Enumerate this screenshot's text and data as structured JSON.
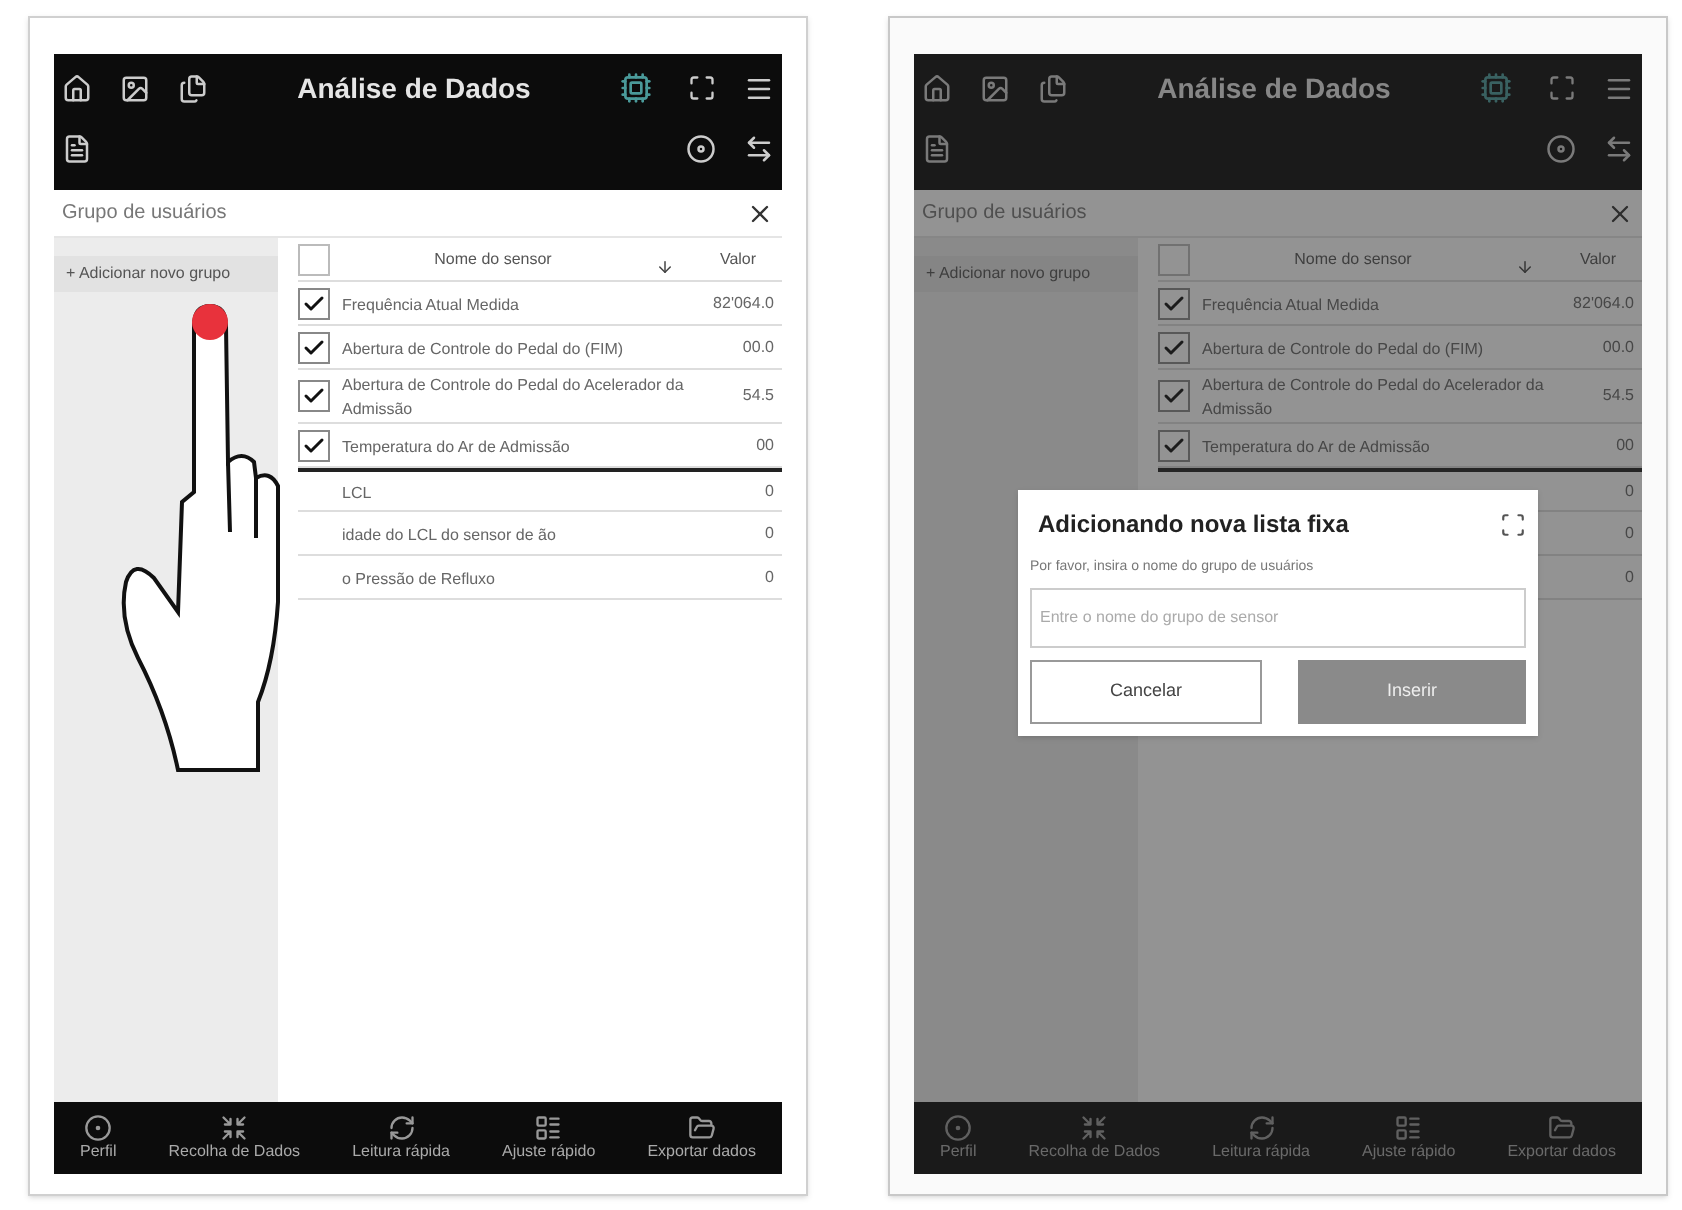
{
  "screens": [
    {
      "title": "Análise de Dados",
      "panel_title": "Grupo de usuários",
      "add_button": "+ Adicionar novo grupo",
      "columns": [
        "Nome do sensor",
        "Valor"
      ],
      "header_checked": false,
      "tap_gesture": true,
      "dimmed": false,
      "rows": [
        {
          "kind": "check",
          "checked": true,
          "name": "Frequência Atual Medida",
          "value": "82'064.0"
        },
        {
          "kind": "check",
          "checked": true,
          "name": "Abertura de Controle do Pedal do (FIM)",
          "value": "00.0"
        },
        {
          "kind": "check",
          "checked": true,
          "name": "Abertura de Controle do Pedal do Acelerador da Admissão",
          "value": "54.5"
        },
        {
          "kind": "check",
          "checked": true,
          "name": "Temperatura do Ar de Admissão",
          "value": "00"
        },
        {
          "kind": "plain",
          "name": "LCL",
          "value": "0"
        },
        {
          "kind": "plain",
          "name": "idade do LCL do sensor de ão",
          "value": "0"
        },
        {
          "kind": "plain",
          "name": "o Pressão de Refluxo",
          "value": "0"
        }
      ],
      "nav": [
        "Perfil",
        "Recolha de Dados",
        "Leitura rápida",
        "Ajuste rápido",
        "Exportar dados"
      ]
    },
    {
      "title": "Análise de Dados",
      "panel_title": "Grupo de usuários",
      "add_button": "+ Adicionar novo grupo",
      "columns": [
        "Nome do sensor",
        "Valor"
      ],
      "header_checked": false,
      "tap_gesture": false,
      "dimmed": true,
      "rows": [
        {
          "kind": "check",
          "checked": true,
          "name": "Frequência Atual Medida",
          "value": "82'064.0"
        },
        {
          "kind": "check",
          "checked": true,
          "name": "Abertura de Controle do Pedal do (FIM)",
          "value": "00.0"
        },
        {
          "kind": "check",
          "checked": true,
          "name": "Abertura de Controle do Pedal do Acelerador da Admissão",
          "value": "54.5"
        },
        {
          "kind": "check",
          "checked": true,
          "name": "Temperatura do Ar de Admissão",
          "value": "00"
        },
        {
          "kind": "plain",
          "value": "0"
        },
        {
          "kind": "plain",
          "value": "0"
        },
        {
          "kind": "plain",
          "value": "0"
        }
      ],
      "nav": [
        "Perfil",
        "Recolha de Dados",
        "Leitura rápida",
        "Ajuste rápido",
        "Exportar dados"
      ],
      "dialog": {
        "title": "Adicionando nova lista fixa",
        "label": "Por favor, insira o nome do grupo de usuários",
        "placeholder": "Entre o nome do grupo de sensor",
        "cancel": "Cancelar",
        "confirm": "Inserir"
      }
    }
  ]
}
